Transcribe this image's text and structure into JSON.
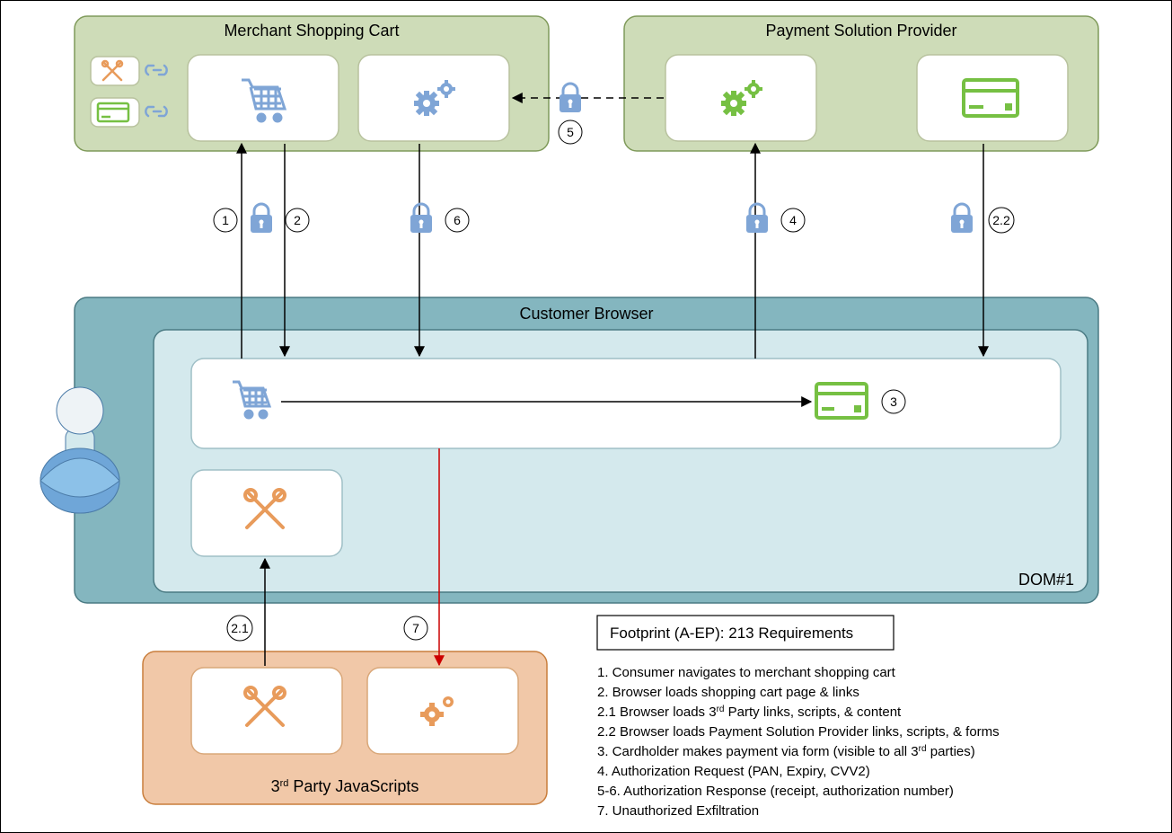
{
  "zones": {
    "merchant": "Merchant Shopping Cart",
    "provider": "Payment Solution Provider",
    "browser": "Customer Browser",
    "dom": "DOM#1",
    "thirdparty_pre": "3",
    "thirdparty_sup": "rd",
    "thirdparty_post": " Party JavaScripts"
  },
  "steps": {
    "s1": "1",
    "s2": "2",
    "s21": "2.1",
    "s22": "2.2",
    "s3": "3",
    "s4": "4",
    "s5": "5",
    "s6": "6",
    "s7": "7"
  },
  "footprint": "Footprint (A-EP): 213 Requirements",
  "legend": {
    "l1": "1. Consumer navigates to merchant shopping cart",
    "l2": "2. Browser loads shopping cart page & links",
    "l21_pre": "2.1 Browser loads 3",
    "l21_sup": "rd",
    "l21_post": " Party links, scripts, & content",
    "l22": "2.2 Browser loads Payment Solution Provider links, scripts, & forms",
    "l3_pre": "3. Cardholder makes payment via form  (visible to all 3",
    "l3_sup": "rd",
    "l3_post": " parties)",
    "l4": "4. Authorization Request (PAN, Expiry, CVV2)",
    "l56": "5-6. Authorization Response (receipt, authorization number)",
    "l7": "7. Unauthorized Exfiltration"
  }
}
